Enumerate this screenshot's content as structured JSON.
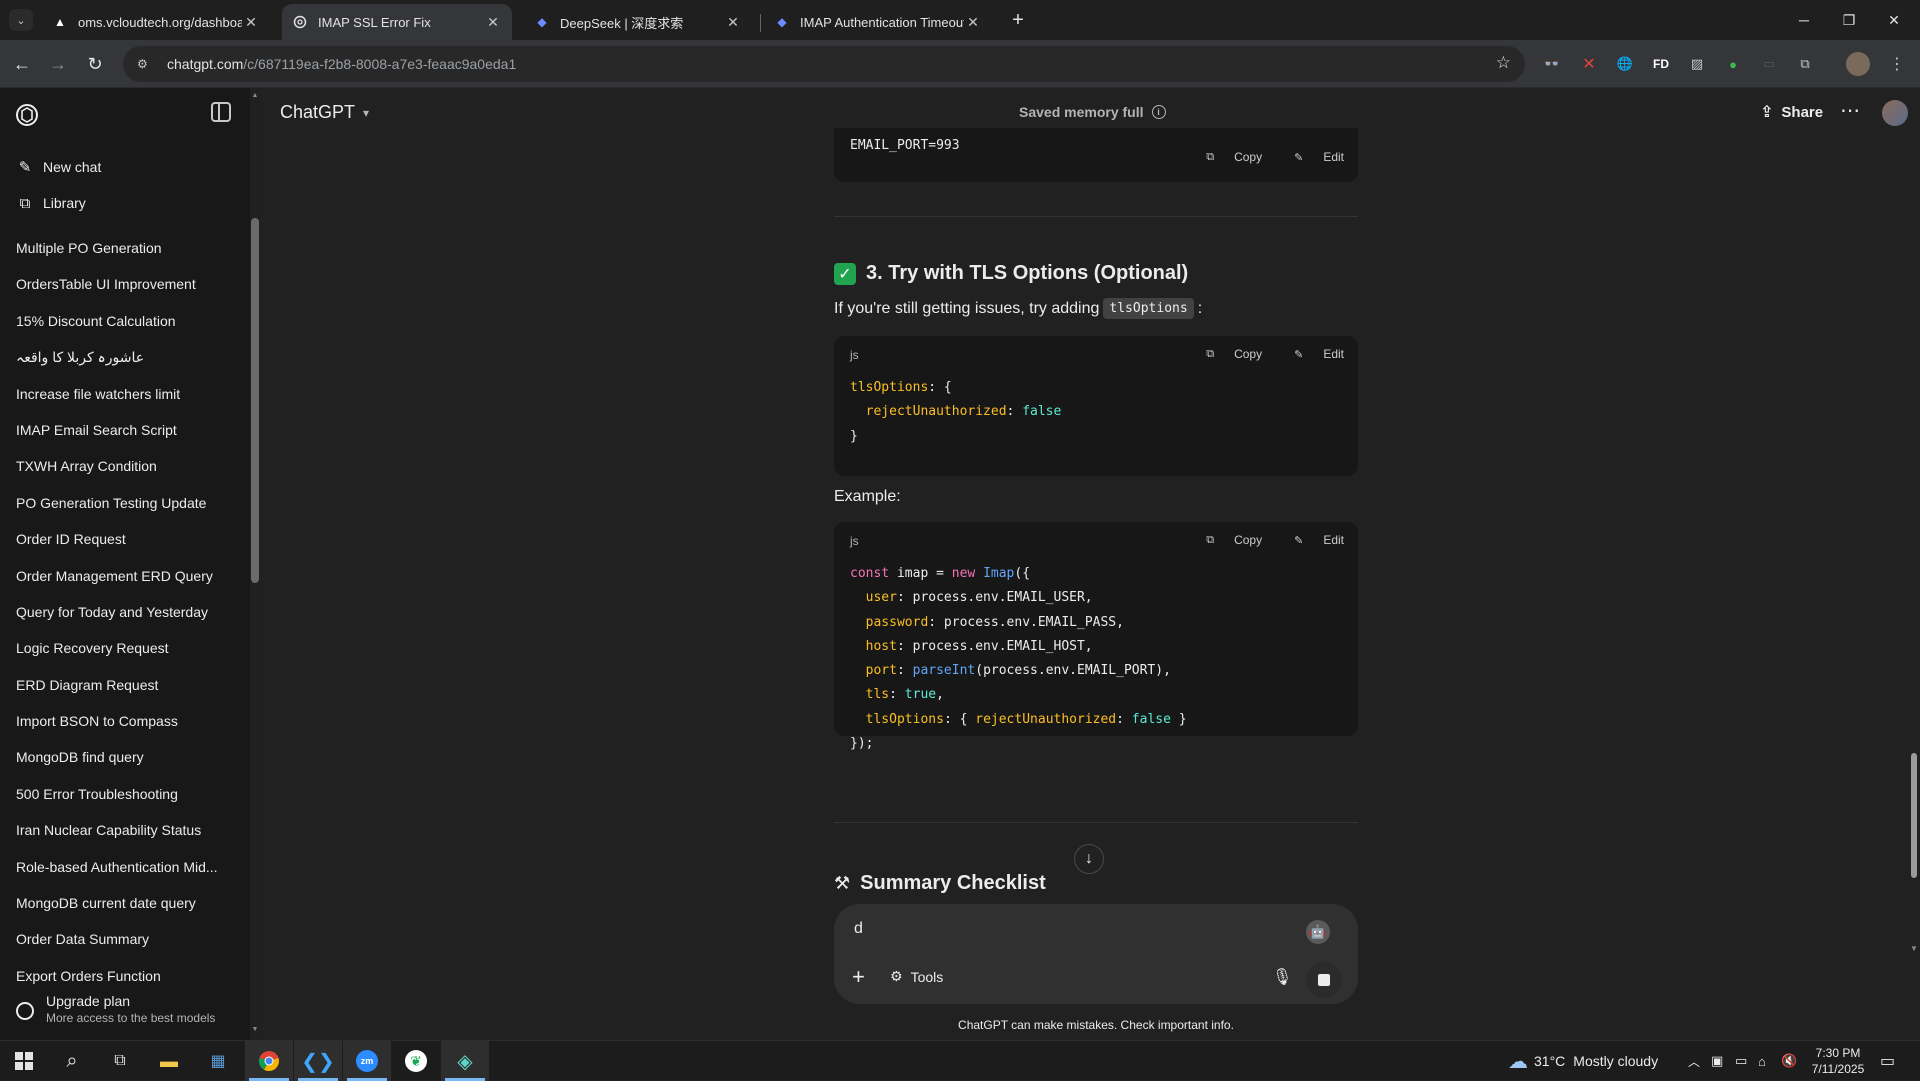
{
  "browser": {
    "tabs": [
      {
        "title": "oms.vcloudtech.org/dashboard",
        "active": false
      },
      {
        "title": "IMAP SSL Error Fix",
        "active": true
      },
      {
        "title": "DeepSeek | 深度求索",
        "active": false
      },
      {
        "title": "IMAP Authentication Timeout E",
        "active": false
      }
    ],
    "url_host": "chatgpt.com",
    "url_path": "/c/687119ea-f2b8-8008-a7e3-feaac9a0eda1",
    "ext_fd_label": "FD"
  },
  "sidebar": {
    "new_chat": "New chat",
    "library": "Library",
    "history": [
      "Multiple PO Generation",
      "OrdersTable UI Improvement",
      "15% Discount Calculation",
      "عاشورہ کربلا کا واقعہ",
      "Increase file watchers limit",
      "IMAP Email Search Script",
      "TXWH Array Condition",
      "PO Generation Testing Update",
      "Order ID Request",
      "Order Management ERD Query",
      "Query for Today and Yesterday",
      "Logic Recovery Request",
      "ERD Diagram Request",
      "Import BSON to Compass",
      "MongoDB find query",
      "500 Error Troubleshooting",
      "Iran Nuclear Capability Status",
      "Role-based Authentication Mid...",
      "MongoDB current date query",
      "Order Data Summary",
      "Export Orders Function"
    ],
    "upgrade_title": "Upgrade plan",
    "upgrade_sub": "More access to the best models"
  },
  "header": {
    "model": "ChatGPT",
    "memory": "Saved memory full",
    "share": "Share"
  },
  "content": {
    "top_code_line": "EMAIL_PORT=993",
    "copy_label": "Copy",
    "edit_label": "Edit",
    "section3_title": "3. Try with TLS Options (Optional)",
    "section3_intro_pre": "If you're still getting issues, try adding",
    "section3_intro_code": "tlsOptions",
    "section3_intro_post": ":",
    "code_lang": "js",
    "example_label": "Example:",
    "summary_title": "Summary Checklist"
  },
  "composer": {
    "value": "d",
    "tools_label": "Tools"
  },
  "disclaimer": "ChatGPT can make mistakes. Check important info.",
  "taskbar": {
    "weather_temp": "31°C",
    "weather_desc": "Mostly cloudy",
    "time": "7:30 PM",
    "date": "7/11/2025"
  },
  "colors": {
    "accent_check": "#22a350",
    "code_keyword": "#f472b6",
    "code_property": "#fbbf24",
    "code_boolean": "#5eead4",
    "code_function": "#60a5fa"
  }
}
